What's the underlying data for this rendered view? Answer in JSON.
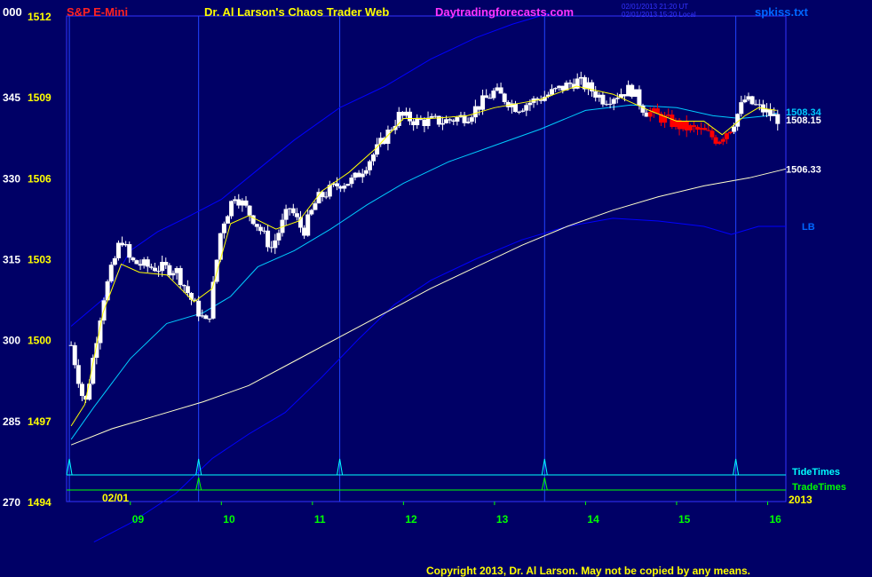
{
  "header": {
    "symbol": "S&P E-Mini",
    "title": "Dr. Al Larson's Chaos Trader Web",
    "website": "Daytradingforecasts.com",
    "timestamp_ut": "02/01/2013 21:20 UT",
    "timestamp_local": "02/01/2013 15:20 Local",
    "file": "spkiss.txt"
  },
  "footer": {
    "copyright": "Copyright 2013, Dr. Al Larson. May not be copied by any means."
  },
  "colors": {
    "background": "#000066",
    "candle_up": "#ffffff",
    "candle_down": "#ff0000",
    "ema_short": "#ffff00",
    "ema_mid": "#00ccff",
    "ema_long": "#ffffcc",
    "band": "#0000ff",
    "tide": "#00ffff",
    "trade": "#00ff00"
  },
  "chart_data": {
    "type": "candlestick",
    "date_label": "02/01",
    "year_label": "2013",
    "ylim": [
      1494,
      1512
    ],
    "y_ticks": [
      {
        "left": "000",
        "right": "1512",
        "value": 1512
      },
      {
        "left": "345",
        "right": "1509",
        "value": 1509
      },
      {
        "left": "330",
        "right": "1506",
        "value": 1506
      },
      {
        "left": "315",
        "right": "1503",
        "value": 1503
      },
      {
        "left": "300",
        "right": "1500",
        "value": 1500
      },
      {
        "left": "285",
        "right": "1497",
        "value": 1497
      },
      {
        "left": "270",
        "right": "1494",
        "value": 1494
      }
    ],
    "x_range": [
      8.3,
      16.2
    ],
    "x_ticks": [
      {
        "label": "09",
        "value": 9
      },
      {
        "label": "10",
        "value": 10
      },
      {
        "label": "11",
        "value": 11
      },
      {
        "label": "12",
        "value": 12
      },
      {
        "label": "13",
        "value": 13
      },
      {
        "label": "14",
        "value": 14
      },
      {
        "label": "15",
        "value": 15
      },
      {
        "label": "16",
        "value": 16
      }
    ],
    "tide_times": [
      8.33,
      9.75,
      11.3,
      13.55,
      15.65
    ],
    "trade_times": [
      9.75,
      13.55
    ],
    "line_labels": [
      {
        "text": "1508.34",
        "value": 1508.45,
        "color": "#00ccff"
      },
      {
        "text": "1508.15",
        "value": 1508.15,
        "color": "#ffffff"
      },
      {
        "text": "1506.33",
        "value": 1506.33,
        "color": "#ffffff"
      },
      {
        "text": "LB",
        "value": 1504.2,
        "color": "#0066ff"
      }
    ],
    "lane_labels": {
      "tide": "TideTimes",
      "trade": "TradeTimes"
    },
    "anchors": {
      "price": [
        [
          8.35,
          1499.8
        ],
        [
          8.5,
          1497.5
        ],
        [
          8.7,
          1501.5
        ],
        [
          8.9,
          1503.8
        ],
        [
          9.0,
          1502.9
        ],
        [
          9.2,
          1502.7
        ],
        [
          9.5,
          1502.6
        ],
        [
          9.7,
          1501.3
        ],
        [
          9.85,
          1500.5
        ],
        [
          10.0,
          1504.2
        ],
        [
          10.15,
          1505.4
        ],
        [
          10.35,
          1504.5
        ],
        [
          10.55,
          1503.4
        ],
        [
          10.75,
          1504.9
        ],
        [
          10.9,
          1504.0
        ],
        [
          11.05,
          1505.2
        ],
        [
          11.3,
          1505.8
        ],
        [
          11.45,
          1505.9
        ],
        [
          11.7,
          1507.0
        ],
        [
          11.95,
          1508.3
        ],
        [
          12.15,
          1508.1
        ],
        [
          12.45,
          1508.1
        ],
        [
          12.7,
          1508.3
        ],
        [
          13.0,
          1509.2
        ],
        [
          13.25,
          1508.6
        ],
        [
          13.6,
          1509.1
        ],
        [
          13.9,
          1509.6
        ],
        [
          14.05,
          1509.3
        ],
        [
          14.2,
          1508.9
        ],
        [
          14.5,
          1509.3
        ],
        [
          14.65,
          1508.5
        ],
        [
          14.85,
          1508.2
        ],
        [
          15.05,
          1507.9
        ],
        [
          15.3,
          1507.7
        ],
        [
          15.45,
          1507.4
        ],
        [
          15.6,
          1507.9
        ],
        [
          15.75,
          1508.9
        ],
        [
          15.9,
          1508.6
        ],
        [
          16.05,
          1508.3
        ],
        [
          16.1,
          1508.2
        ]
      ],
      "ema_short": [
        [
          8.35,
          1496.8
        ],
        [
          8.5,
          1497.6
        ],
        [
          8.7,
          1501.0
        ],
        [
          8.9,
          1502.8
        ],
        [
          9.1,
          1502.5
        ],
        [
          9.4,
          1502.4
        ],
        [
          9.7,
          1501.4
        ],
        [
          9.9,
          1501.9
        ],
        [
          10.1,
          1504.3
        ],
        [
          10.3,
          1504.6
        ],
        [
          10.6,
          1504.1
        ],
        [
          10.85,
          1504.4
        ],
        [
          11.1,
          1505.5
        ],
        [
          11.4,
          1506.2
        ],
        [
          11.7,
          1507.1
        ],
        [
          12.0,
          1508.2
        ],
        [
          12.3,
          1508.2
        ],
        [
          12.7,
          1508.3
        ],
        [
          13.0,
          1508.6
        ],
        [
          13.5,
          1508.9
        ],
        [
          13.9,
          1509.4
        ],
        [
          14.3,
          1509.1
        ],
        [
          14.7,
          1508.5
        ],
        [
          15.0,
          1508.1
        ],
        [
          15.3,
          1508.1
        ],
        [
          15.5,
          1507.6
        ],
        [
          15.75,
          1508.3
        ],
        [
          15.9,
          1508.6
        ],
        [
          16.1,
          1508.5
        ]
      ],
      "ema_mid": [
        [
          8.35,
          1496.3
        ],
        [
          8.6,
          1497.5
        ],
        [
          9.0,
          1499.3
        ],
        [
          9.4,
          1500.6
        ],
        [
          9.8,
          1501.0
        ],
        [
          10.1,
          1501.6
        ],
        [
          10.4,
          1502.7
        ],
        [
          10.8,
          1503.3
        ],
        [
          11.2,
          1504.1
        ],
        [
          11.6,
          1505.0
        ],
        [
          12.0,
          1505.8
        ],
        [
          12.5,
          1506.6
        ],
        [
          13.0,
          1507.2
        ],
        [
          13.5,
          1507.8
        ],
        [
          14.0,
          1508.5
        ],
        [
          14.5,
          1508.7
        ],
        [
          15.0,
          1508.6
        ],
        [
          15.4,
          1508.3
        ],
        [
          15.7,
          1508.2
        ],
        [
          16.0,
          1508.3
        ],
        [
          16.1,
          1508.4
        ]
      ],
      "ema_long": [
        [
          8.35,
          1496.1
        ],
        [
          8.8,
          1496.7
        ],
        [
          9.3,
          1497.2
        ],
        [
          9.8,
          1497.7
        ],
        [
          10.3,
          1498.3
        ],
        [
          10.8,
          1499.2
        ],
        [
          11.3,
          1500.1
        ],
        [
          11.8,
          1501.0
        ],
        [
          12.3,
          1501.9
        ],
        [
          12.8,
          1502.7
        ],
        [
          13.3,
          1503.5
        ],
        [
          13.8,
          1504.2
        ],
        [
          14.3,
          1504.8
        ],
        [
          14.8,
          1505.3
        ],
        [
          15.3,
          1505.7
        ],
        [
          15.8,
          1506.0
        ],
        [
          16.2,
          1506.33
        ]
      ],
      "band_upper": [
        [
          8.35,
          1500.5
        ],
        [
          8.7,
          1501.5
        ],
        [
          9.0,
          1503.3
        ],
        [
          9.3,
          1504.0
        ],
        [
          9.6,
          1504.5
        ],
        [
          10.0,
          1505.2
        ],
        [
          10.4,
          1506.3
        ],
        [
          10.8,
          1507.4
        ],
        [
          11.3,
          1508.6
        ],
        [
          11.8,
          1509.4
        ],
        [
          12.3,
          1510.4
        ],
        [
          12.8,
          1511.2
        ],
        [
          13.2,
          1511.7
        ],
        [
          13.6,
          1512.1
        ]
      ],
      "band_lower": [
        [
          8.6,
          1492.5
        ],
        [
          9.0,
          1493.2
        ],
        [
          9.5,
          1494.3
        ],
        [
          9.9,
          1495.6
        ],
        [
          10.3,
          1496.5
        ],
        [
          10.7,
          1497.3
        ],
        [
          11.1,
          1498.6
        ],
        [
          11.5,
          1500.0
        ],
        [
          11.9,
          1501.3
        ],
        [
          12.3,
          1502.2
        ],
        [
          12.8,
          1503.0
        ],
        [
          13.3,
          1503.7
        ],
        [
          13.8,
          1504.2
        ],
        [
          14.3,
          1504.5
        ],
        [
          14.8,
          1504.4
        ],
        [
          15.3,
          1504.2
        ],
        [
          15.6,
          1503.9
        ],
        [
          15.9,
          1504.2
        ],
        [
          16.2,
          1504.2
        ]
      ]
    },
    "down_segments": [
      [
        14.7,
        15.6
      ]
    ],
    "bar_step": 0.04,
    "seed": 7
  }
}
